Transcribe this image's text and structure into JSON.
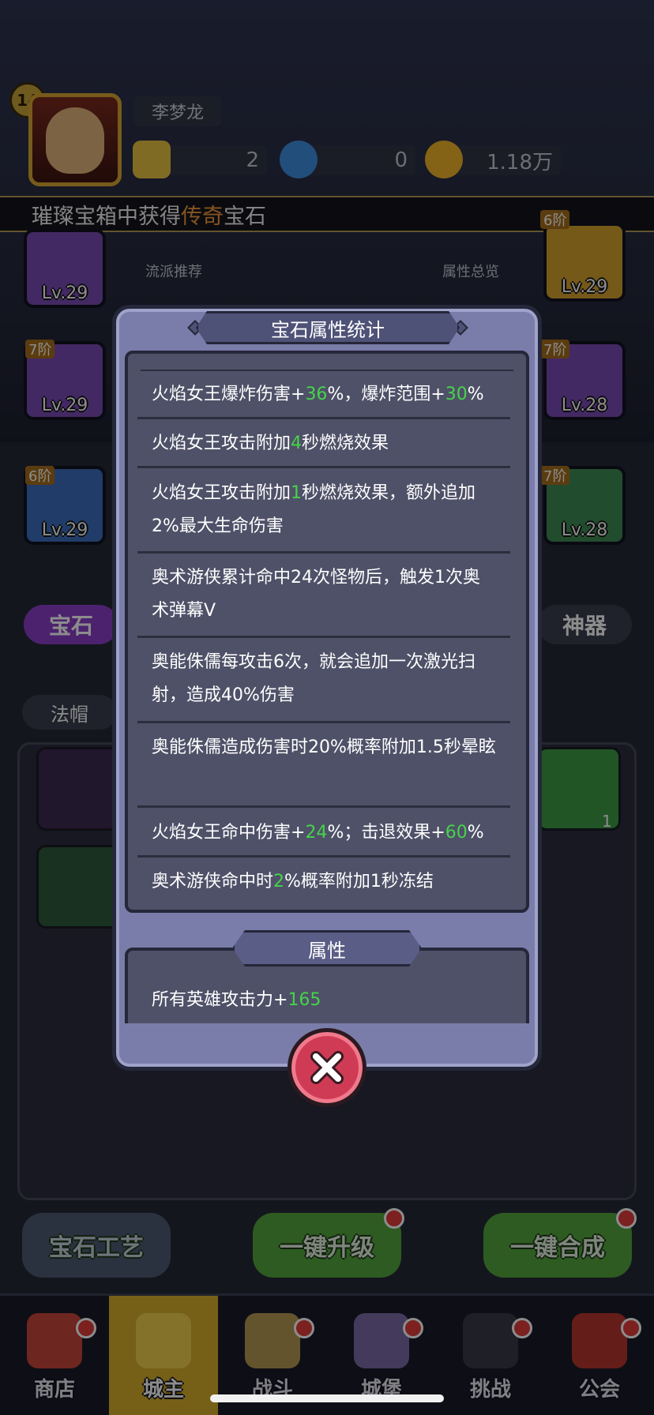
{
  "player": {
    "level": "14",
    "name": "李梦龙",
    "resources": [
      {
        "icon": "gold-gem-icon",
        "value": "2"
      },
      {
        "icon": "potion-icon",
        "value": "0"
      },
      {
        "icon": "coin-icon",
        "value": "1.18万"
      }
    ]
  },
  "banner": {
    "prefix": "璀璨宝箱中获得",
    "highlight": "传奇",
    "suffix": "宝石"
  },
  "background": {
    "side_labels": [
      "流派推荐",
      "属性总览"
    ],
    "slots_left": [
      {
        "tier": "",
        "level": "Lv.29",
        "color": "purple"
      },
      {
        "tier": "7阶",
        "level": "Lv.29",
        "color": "purple"
      },
      {
        "tier": "6阶",
        "level": "Lv.29",
        "color": "blue"
      }
    ],
    "slots_right": [
      {
        "tier": "6阶",
        "level": "Lv.29",
        "color": "gold"
      },
      {
        "tier": "7阶",
        "level": "Lv.28",
        "color": "purple"
      },
      {
        "tier": "7阶",
        "level": "Lv.28",
        "color": "green"
      }
    ],
    "tab_gem": "宝石",
    "tab_artifact": "神器",
    "filter": "法帽",
    "gem_count": "1",
    "buttons": [
      "宝石工艺",
      "一键升级",
      "一键合成"
    ]
  },
  "nav": [
    {
      "label": "商店",
      "icon": "shop-icon",
      "badge": true
    },
    {
      "label": "城主",
      "icon": "crown-icon",
      "badge": false,
      "active": true
    },
    {
      "label": "战斗",
      "icon": "swords-icon",
      "badge": true
    },
    {
      "label": "城堡",
      "icon": "castle-icon",
      "badge": true
    },
    {
      "label": "挑战",
      "icon": "demon-icon",
      "badge": true
    },
    {
      "label": "公会",
      "icon": "guild-icon",
      "badge": true
    }
  ],
  "modal": {
    "title": "宝石属性统计",
    "stats": [
      {
        "parts": [
          [
            "火焰女王爆炸伤害+",
            false
          ],
          [
            "36",
            true
          ],
          [
            "%，爆炸范围+",
            false
          ],
          [
            "30",
            true
          ],
          [
            "%",
            false
          ]
        ]
      },
      {
        "parts": [
          [
            "火焰女王攻击附加",
            false
          ],
          [
            "4",
            true
          ],
          [
            "秒燃烧效果",
            false
          ]
        ]
      },
      {
        "parts": [
          [
            "火焰女王攻击附加",
            false
          ],
          [
            "1",
            true
          ],
          [
            "秒燃烧效果，额外追加2%最大生命伤害",
            false
          ]
        ]
      },
      {
        "parts": [
          [
            "奥术游侠累计命中24次怪物后，触发1次奥术弹幕V",
            false
          ]
        ]
      },
      {
        "parts": [
          [
            "奥能侏儒每攻击6次，就会追加一次激光扫射，造成40%伤害",
            false
          ]
        ]
      },
      {
        "parts": [
          [
            "奥能侏儒造成伤害时20%概率附加1.5秒晕眩",
            false
          ]
        ]
      },
      {
        "parts": [
          [
            "火焰女王命中伤害+",
            false
          ],
          [
            "24",
            true
          ],
          [
            "%；击退效果+",
            false
          ],
          [
            "60",
            true
          ],
          [
            "%",
            false
          ]
        ]
      },
      {
        "parts": [
          [
            "奥术游侠命中时",
            false
          ],
          [
            "2",
            true
          ],
          [
            "%概率附加1秒冻结",
            false
          ]
        ]
      }
    ],
    "attr_title": "属性",
    "attr_prefix": "所有英雄攻击力+",
    "attr_value": "165",
    "close_icon": "close-x-icon"
  },
  "colors": {
    "green_value": "#46d34b",
    "orange_highlight": "#f39a3d",
    "modal_bg": "#7a7ca9",
    "list_bg": "#4f5168"
  }
}
